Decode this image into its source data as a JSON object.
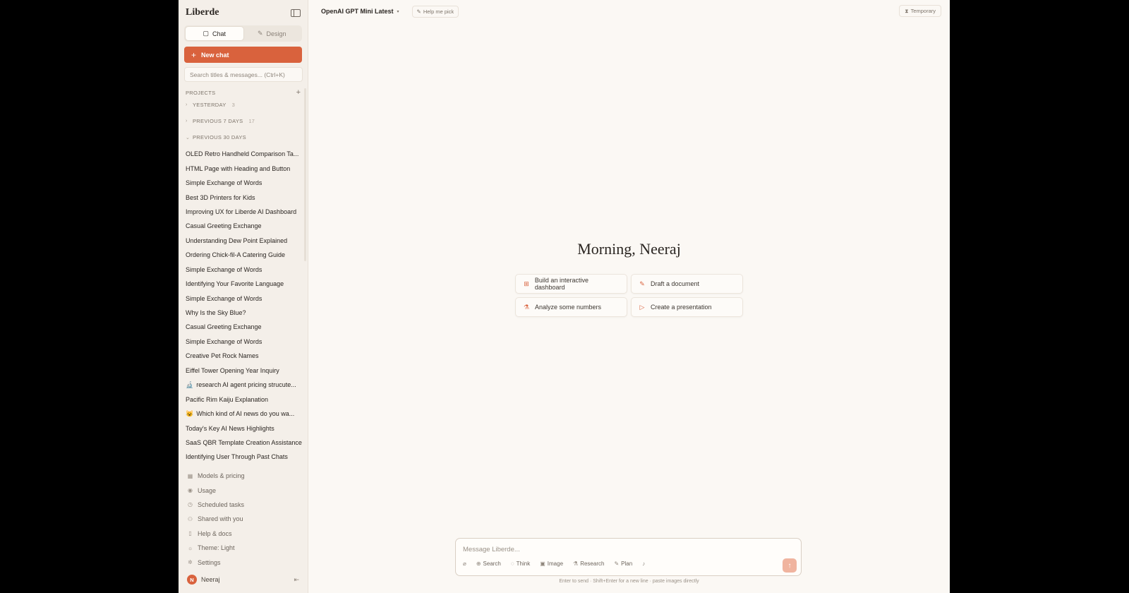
{
  "sidebar": {
    "brand": "Liberde",
    "tabs": [
      {
        "label": "Chat",
        "icon": "speech-bubble-icon"
      },
      {
        "label": "Design",
        "icon": "pencil-icon"
      }
    ],
    "new_chat_label": "New chat",
    "search_placeholder": "Search titles & messages... (Ctrl+K)",
    "projects_label": "PROJECTS",
    "groups": [
      {
        "name": "YESTERDAY",
        "count": "3",
        "expanded": false
      },
      {
        "name": "PREVIOUS 7 DAYS",
        "count": "17",
        "expanded": false
      },
      {
        "name": "PREVIOUS 30 DAYS",
        "count": "",
        "expanded": true
      }
    ],
    "chats": [
      {
        "title": "OLED Retro Handheld Comparison Ta...",
        "emoji": ""
      },
      {
        "title": "HTML Page with Heading and Button",
        "emoji": ""
      },
      {
        "title": "Simple Exchange of Words",
        "emoji": ""
      },
      {
        "title": "Best 3D Printers for Kids",
        "emoji": ""
      },
      {
        "title": "Improving UX for Liberde AI Dashboard",
        "emoji": ""
      },
      {
        "title": "Casual Greeting Exchange",
        "emoji": ""
      },
      {
        "title": "Understanding Dew Point Explained",
        "emoji": ""
      },
      {
        "title": "Ordering Chick-fil-A Catering Guide",
        "emoji": ""
      },
      {
        "title": "Simple Exchange of Words",
        "emoji": ""
      },
      {
        "title": "Identifying Your Favorite Language",
        "emoji": ""
      },
      {
        "title": "Simple Exchange of Words",
        "emoji": ""
      },
      {
        "title": "Why Is the Sky Blue?",
        "emoji": ""
      },
      {
        "title": "Casual Greeting Exchange",
        "emoji": ""
      },
      {
        "title": "Simple Exchange of Words",
        "emoji": ""
      },
      {
        "title": "Creative Pet Rock Names",
        "emoji": ""
      },
      {
        "title": "Eiffel Tower Opening Year Inquiry",
        "emoji": ""
      },
      {
        "title": "research AI agent pricing strucute...",
        "emoji": "🔬"
      },
      {
        "title": "Pacific Rim Kaiju Explanation",
        "emoji": ""
      },
      {
        "title": "Which kind of AI news do you wa...",
        "emoji": "😺"
      },
      {
        "title": "Today's Key AI News Highlights",
        "emoji": ""
      },
      {
        "title": "SaaS QBR Template Creation Assistance",
        "emoji": ""
      },
      {
        "title": "Identifying User Through Past Chats",
        "emoji": ""
      }
    ],
    "nav": [
      {
        "label": "Models & pricing",
        "icon": "grid-icon",
        "glyph": "▦"
      },
      {
        "label": "Usage",
        "icon": "chart-icon",
        "glyph": "◉"
      },
      {
        "label": "Scheduled tasks",
        "icon": "clock-icon",
        "glyph": "◷"
      },
      {
        "label": "Shared with you",
        "icon": "users-icon",
        "glyph": "⚇"
      },
      {
        "label": "Help & docs",
        "icon": "book-icon",
        "glyph": "▯"
      },
      {
        "label": "Theme: Light",
        "icon": "sun-icon",
        "glyph": "☼"
      },
      {
        "label": "Settings",
        "icon": "gear-icon",
        "glyph": "✲"
      }
    ],
    "user": {
      "initial": "N",
      "name": "Neeraj"
    }
  },
  "topbar": {
    "model": "OpenAI GPT Mini Latest",
    "help_pick": "Help me pick",
    "temporary": "Temporary"
  },
  "main": {
    "greeting": "Morning, Neeraj",
    "suggestions": [
      {
        "label": "Build an interactive dashboard",
        "icon": "dashboard-icon",
        "glyph": "⊞"
      },
      {
        "label": "Draft a document",
        "icon": "pencil-icon",
        "glyph": "✎"
      },
      {
        "label": "Analyze some numbers",
        "icon": "flask-icon",
        "glyph": "⚗"
      },
      {
        "label": "Create a presentation",
        "icon": "play-icon",
        "glyph": "▷"
      }
    ]
  },
  "composer": {
    "placeholder": "Message Liberde...",
    "tools": [
      {
        "label": "",
        "icon": "paperclip-icon",
        "glyph": "⌀"
      },
      {
        "label": "Search",
        "icon": "globe-icon",
        "glyph": "⊕"
      },
      {
        "label": "Think",
        "icon": "bulb-icon",
        "glyph": "◌"
      },
      {
        "label": "Image",
        "icon": "image-icon",
        "glyph": "▣"
      },
      {
        "label": "Research",
        "icon": "flask-icon",
        "glyph": "⚗"
      },
      {
        "label": "Plan",
        "icon": "pen-icon",
        "glyph": "✎"
      },
      {
        "label": "",
        "icon": "microphone-icon",
        "glyph": "♪"
      }
    ],
    "hint": "Enter to send · Shift+Enter for a new line · paste images directly"
  },
  "colors": {
    "accent": "#d9623d",
    "sidebar_bg": "#f4efe9",
    "main_bg": "#fbf8f4"
  }
}
